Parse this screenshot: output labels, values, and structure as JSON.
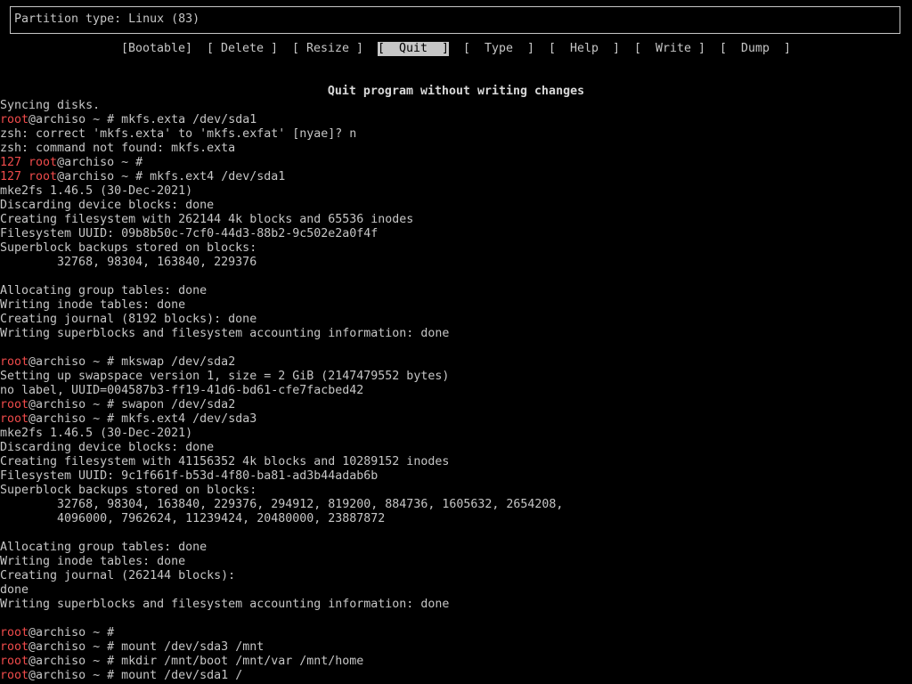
{
  "partition_header": {
    "label": "Partition type: Linux (83)"
  },
  "menu": [
    {
      "label": "[Bootable]",
      "selected": false
    },
    {
      "label": "[ Delete ]",
      "selected": false
    },
    {
      "label": "[ Resize ]",
      "selected": false
    },
    {
      "label": "[  Quit  ]",
      "selected": true
    },
    {
      "label": "[  Type  ]",
      "selected": false
    },
    {
      "label": "[  Help  ]",
      "selected": false
    },
    {
      "label": "[  Write ]",
      "selected": false
    },
    {
      "label": "[  Dump  ]",
      "selected": false
    }
  ],
  "hint": "Quit program without writing changes",
  "colors": {
    "background": "#000000",
    "text": "#c6c6c6",
    "prompt_red": "#ef4b4b",
    "selected_bg": "#c6c6c6"
  },
  "terminal": {
    "lines": [
      {
        "type": "out",
        "text": "Syncing disks."
      },
      {
        "type": "cmd",
        "exit": "",
        "user": "root",
        "host": "@archiso ~ # ",
        "cmd": "mkfs.exta /dev/sda1"
      },
      {
        "type": "out",
        "text": "zsh: correct 'mkfs.exta' to 'mkfs.exfat' [nyae]? n"
      },
      {
        "type": "out",
        "text": "zsh: command not found: mkfs.exta"
      },
      {
        "type": "cmd",
        "exit": "127 ",
        "user": "root",
        "host": "@archiso ~ # ",
        "cmd": ""
      },
      {
        "type": "cmd",
        "exit": "127 ",
        "user": "root",
        "host": "@archiso ~ # ",
        "cmd": "mkfs.ext4 /dev/sda1"
      },
      {
        "type": "out",
        "text": "mke2fs 1.46.5 (30-Dec-2021)"
      },
      {
        "type": "out",
        "text": "Discarding device blocks: done"
      },
      {
        "type": "out",
        "text": "Creating filesystem with 262144 4k blocks and 65536 inodes"
      },
      {
        "type": "out",
        "text": "Filesystem UUID: 09b8b50c-7cf0-44d3-88b2-9c502e2a0f4f"
      },
      {
        "type": "out",
        "text": "Superblock backups stored on blocks:"
      },
      {
        "type": "out",
        "text": "        32768, 98304, 163840, 229376"
      },
      {
        "type": "out",
        "text": ""
      },
      {
        "type": "out",
        "text": "Allocating group tables: done"
      },
      {
        "type": "out",
        "text": "Writing inode tables: done"
      },
      {
        "type": "out",
        "text": "Creating journal (8192 blocks): done"
      },
      {
        "type": "out",
        "text": "Writing superblocks and filesystem accounting information: done"
      },
      {
        "type": "out",
        "text": ""
      },
      {
        "type": "cmd",
        "exit": "",
        "user": "root",
        "host": "@archiso ~ # ",
        "cmd": "mkswap /dev/sda2"
      },
      {
        "type": "out",
        "text": "Setting up swapspace version 1, size = 2 GiB (2147479552 bytes)"
      },
      {
        "type": "out",
        "text": "no label, UUID=004587b3-ff19-41d6-bd61-cfe7facbed42"
      },
      {
        "type": "cmd",
        "exit": "",
        "user": "root",
        "host": "@archiso ~ # ",
        "cmd": "swapon /dev/sda2"
      },
      {
        "type": "cmd",
        "exit": "",
        "user": "root",
        "host": "@archiso ~ # ",
        "cmd": "mkfs.ext4 /dev/sda3"
      },
      {
        "type": "out",
        "text": "mke2fs 1.46.5 (30-Dec-2021)"
      },
      {
        "type": "out",
        "text": "Discarding device blocks: done"
      },
      {
        "type": "out",
        "text": "Creating filesystem with 41156352 4k blocks and 10289152 inodes"
      },
      {
        "type": "out",
        "text": "Filesystem UUID: 9c1f661f-b53d-4f80-ba81-ad3b44adab6b"
      },
      {
        "type": "out",
        "text": "Superblock backups stored on blocks:"
      },
      {
        "type": "out",
        "text": "        32768, 98304, 163840, 229376, 294912, 819200, 884736, 1605632, 2654208,"
      },
      {
        "type": "out",
        "text": "        4096000, 7962624, 11239424, 20480000, 23887872"
      },
      {
        "type": "out",
        "text": ""
      },
      {
        "type": "out",
        "text": "Allocating group tables: done"
      },
      {
        "type": "out",
        "text": "Writing inode tables: done"
      },
      {
        "type": "out",
        "text": "Creating journal (262144 blocks):"
      },
      {
        "type": "out",
        "text": "done"
      },
      {
        "type": "out",
        "text": "Writing superblocks and filesystem accounting information: done"
      },
      {
        "type": "out",
        "text": ""
      },
      {
        "type": "cmd",
        "exit": "",
        "user": "root",
        "host": "@archiso ~ # ",
        "cmd": ""
      },
      {
        "type": "cmd",
        "exit": "",
        "user": "root",
        "host": "@archiso ~ # ",
        "cmd": "mount /dev/sda3 /mnt"
      },
      {
        "type": "cmd",
        "exit": "",
        "user": "root",
        "host": "@archiso ~ # ",
        "cmd": "mkdir /mnt/boot /mnt/var /mnt/home"
      },
      {
        "type": "cmd",
        "exit": "",
        "user": "root",
        "host": "@archiso ~ # ",
        "cmd": "mount /dev/sda1 /"
      }
    ]
  }
}
